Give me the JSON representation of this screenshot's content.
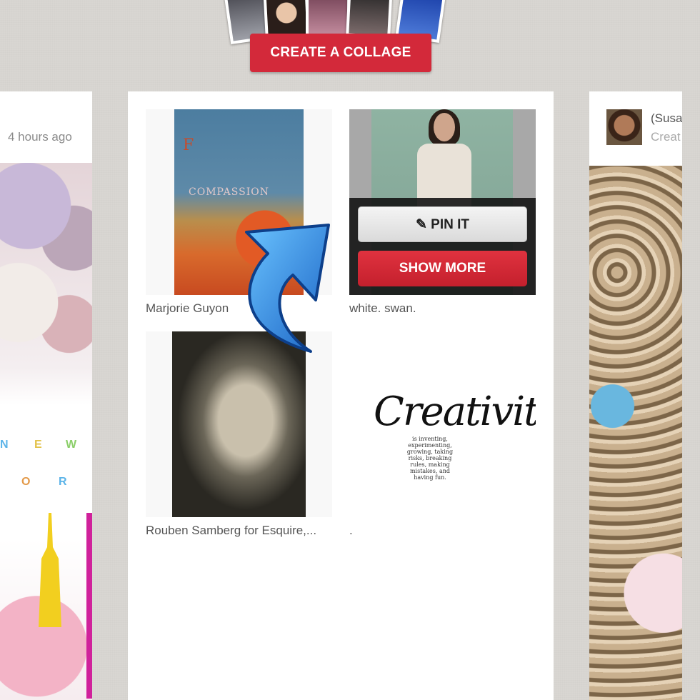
{
  "header": {
    "create_collage_label": "CREATE A COLLAGE"
  },
  "left_card": {
    "time": "4 hours ago",
    "art_letters": [
      "N",
      "E",
      "W",
      "O",
      "R"
    ]
  },
  "middle_card": {
    "items": [
      {
        "caption": "Marjorie Guyon",
        "art_title": "F",
        "art_text": "COMPASSION"
      },
      {
        "caption": "white. swan."
      },
      {
        "caption": "Rouben Samberg for Esquire,..."
      },
      {
        "caption": ".",
        "art_title": "Creativity",
        "art_sub": "is inventing, experimenting, growing, taking risks, breaking rules, making mistakes, and having fun."
      }
    ],
    "pin_it_label": "PIN IT",
    "show_more_label": "SHOW MORE"
  },
  "right_card": {
    "user": "(Susa",
    "sub": "Creat"
  },
  "colors": {
    "brand_red": "#d3293a",
    "background": "#d9d6d2",
    "arrow_blue": "#2f8fe0"
  }
}
